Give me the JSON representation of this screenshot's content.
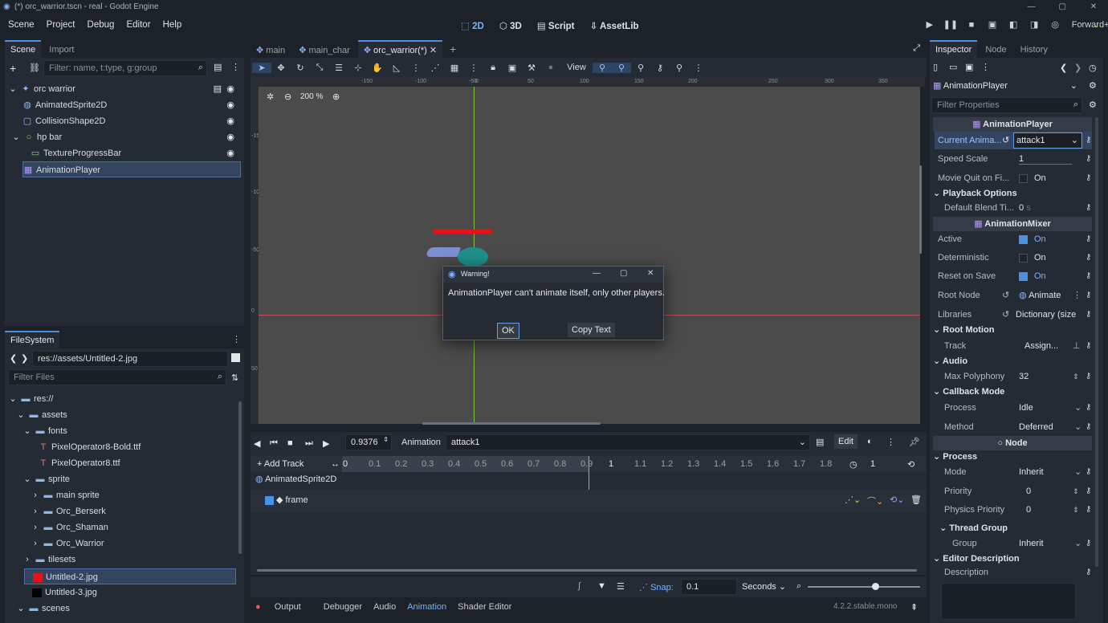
{
  "window": {
    "title": "(*) orc_warrior.tscn - real - Godot Engine",
    "controls": [
      "—",
      "▢",
      "✕"
    ]
  },
  "menu": [
    "Scene",
    "Project",
    "Debug",
    "Editor",
    "Help"
  ],
  "modes": [
    "2D",
    "3D",
    "Script",
    "AssetLib"
  ],
  "renderer": "Forward+",
  "scene_dock": {
    "tabs": [
      "Scene",
      "Import"
    ],
    "filter_placeholder": "Filter: name, t:type, g:group",
    "nodes": [
      "orc warrior",
      "AnimatedSprite2D",
      "CollisionShape2D",
      "hp bar",
      "TextureProgressBar",
      "AnimationPlayer"
    ]
  },
  "filesystem": {
    "tab": "FileSystem",
    "path": "res://assets/Untitled-2.jpg",
    "filter_placeholder": "Filter Files",
    "items": [
      "res://",
      "assets",
      "fonts",
      "PixelOperator8-Bold.ttf",
      "PixelOperator8.ttf",
      "sprite",
      "main sprite",
      "Orc_Berserk",
      "Orc_Shaman",
      "Orc_Warrior",
      "tilesets",
      "Untitled-2.jpg",
      "Untitled-3.jpg",
      "scenes"
    ]
  },
  "editor_tabs": [
    "main",
    "main_char",
    "orc_warrior(*)"
  ],
  "toolbar": {
    "view_label": "View"
  },
  "viewport": {
    "zoom": "200 %",
    "ruler_top": [
      "-150",
      "-100",
      "-50",
      "0",
      "50",
      "100",
      "150",
      "200",
      "250",
      "300",
      "350"
    ],
    "ruler_left": [
      "-150",
      "-100",
      "-50",
      "0",
      "50"
    ]
  },
  "dialog": {
    "title": "Warning!",
    "message": "AnimationPlayer can't animate itself, only other players.",
    "ok": "OK",
    "copy": "Copy Text"
  },
  "animation": {
    "time": "0.9376",
    "label": "Animation",
    "current": "attack1",
    "edit": "Edit",
    "add_track": "Add Track",
    "ticks": [
      "0",
      "0.1",
      "0.2",
      "0.3",
      "0.4",
      "0.5",
      "0.6",
      "0.7",
      "0.8",
      "0.9",
      "1",
      "1.1",
      "1.2",
      "1.3",
      "1.4",
      "1.5",
      "1.6",
      "1.7",
      "1.8"
    ],
    "length": "1",
    "track_node": "AnimatedSprite2D",
    "track_prop": "frame",
    "snap_label": "Snap:",
    "snap_value": "0.1",
    "snap_unit": "Seconds"
  },
  "bottom_tabs": [
    "Output",
    "Debugger",
    "Audio",
    "Animation",
    "Shader Editor"
  ],
  "version": "4.2.2.stable.mono",
  "inspector": {
    "tabs": [
      "Inspector",
      "Node",
      "History"
    ],
    "object": "AnimationPlayer",
    "filter_placeholder": "Filter Properties",
    "sections": {
      "animplayer": "AnimationPlayer",
      "playback": "Playback Options",
      "mixer": "AnimationMixer",
      "root_motion": "Root Motion",
      "audio": "Audio",
      "callback": "Callback Mode",
      "node": "Node",
      "process": "Process",
      "thread": "Thread Group",
      "editor_desc": "Editor Description"
    },
    "props": {
      "current_anim": "Current Anima...",
      "current_anim_val": "attack1",
      "speed_scale": "Speed Scale",
      "speed_scale_val": "1",
      "movie_quit": "Movie Quit on Fi...",
      "movie_quit_val": "On",
      "blend": "Default Blend Ti...",
      "blend_val": "0",
      "blend_unit": "s",
      "active": "Active",
      "active_val": "On",
      "deterministic": "Deterministic",
      "deterministic_val": "On",
      "reset_on_save": "Reset on Save",
      "reset_on_save_val": "On",
      "root_node": "Root Node",
      "root_node_val": "Animate",
      "libraries": "Libraries",
      "libraries_val": "Dictionary (size",
      "track": "Track",
      "track_val": "Assign...",
      "max_poly": "Max Polyphony",
      "max_poly_val": "32",
      "process": "Process",
      "process_val": "Idle",
      "method": "Method",
      "method_val": "Deferred",
      "mode": "Mode",
      "mode_val": "Inherit",
      "priority": "Priority",
      "priority_val": "0",
      "phys_priority": "Physics Priority",
      "phys_priority_val": "0",
      "group": "Group",
      "group_val": "Inherit",
      "description": "Description"
    }
  },
  "colors": {
    "accent": "#4d8fe3",
    "hpbar": "#e0141a",
    "bg": "#1d2229",
    "panel": "#252b34"
  }
}
